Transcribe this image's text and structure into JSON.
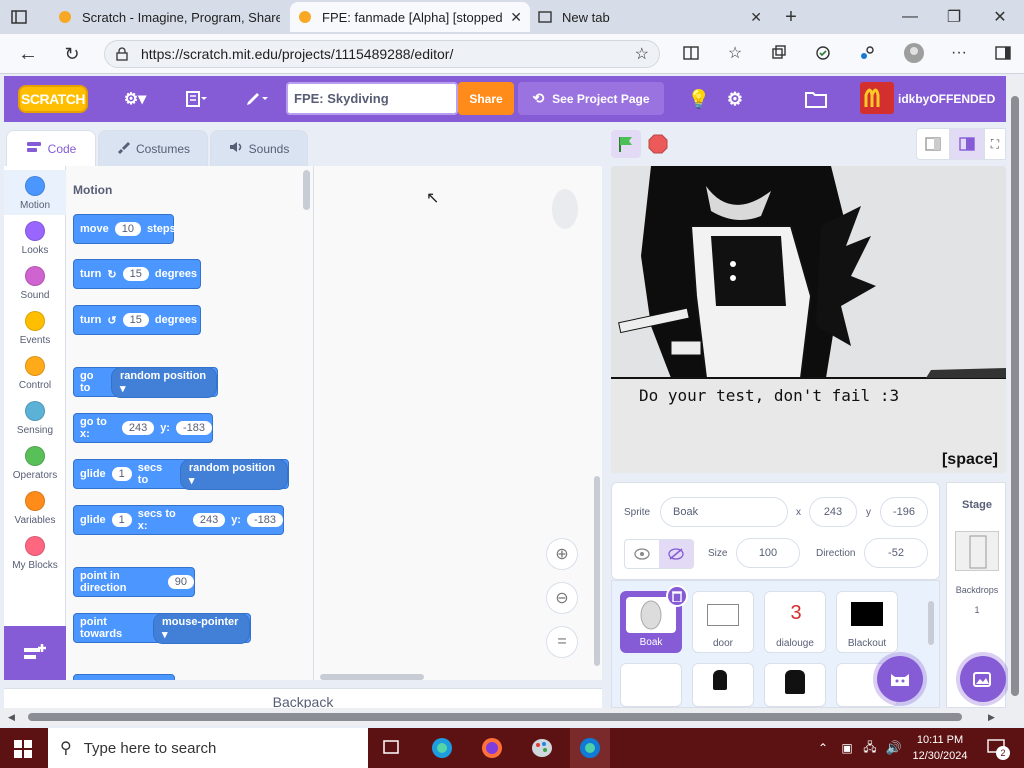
{
  "browser": {
    "tabs": [
      {
        "title": "Scratch - Imagine, Program, Share",
        "favicon": "scratch-favicon"
      },
      {
        "title": "FPE: fanmade [Alpha] [stopped up",
        "favicon": "scratch-favicon"
      },
      {
        "title": "New tab",
        "favicon": "new-tab-icon"
      }
    ],
    "url": "https://scratch.mit.edu/projects/1115489288/editor/",
    "window_controls": [
      "—",
      "❐",
      "✕"
    ]
  },
  "menubar": {
    "logo": "SCRATCH",
    "project_title": "FPE: Skydiving",
    "share_label": "Share",
    "see_project_label": "See Project Page",
    "username": "idkbyOFFENDED"
  },
  "editor_tabs": [
    "Code",
    "Costumes",
    "Sounds"
  ],
  "categories": [
    {
      "label": "Motion",
      "color": "#4c97ff"
    },
    {
      "label": "Looks",
      "color": "#9966ff"
    },
    {
      "label": "Sound",
      "color": "#cf63cf"
    },
    {
      "label": "Events",
      "color": "#ffbf00"
    },
    {
      "label": "Control",
      "color": "#ffab19"
    },
    {
      "label": "Sensing",
      "color": "#5cb1d6"
    },
    {
      "label": "Operators",
      "color": "#59c059"
    },
    {
      "label": "Variables",
      "color": "#ff8c1a"
    },
    {
      "label": "My Blocks",
      "color": "#ff6680"
    }
  ],
  "palette": {
    "heading": "Motion",
    "blocks": {
      "move": {
        "a": "move",
        "v": "10",
        "b": "steps"
      },
      "turn_cw": {
        "a": "turn",
        "v": "15",
        "b": "degrees"
      },
      "turn_ccw": {
        "a": "turn",
        "v": "15",
        "b": "degrees"
      },
      "goto": {
        "a": "go to",
        "dd": "random position"
      },
      "gotoxy": {
        "a": "go to x:",
        "x": "243",
        "b": "y:",
        "y": "-183"
      },
      "glide": {
        "a": "glide",
        "v": "1",
        "b": "secs to",
        "dd": "random position"
      },
      "glidexy": {
        "a": "glide",
        "v": "1",
        "b": "secs to x:",
        "x": "243",
        "c": "y:",
        "y": "-183"
      },
      "point_dir": {
        "a": "point in direction",
        "v": "90"
      },
      "point_towards": {
        "a": "point towards",
        "dd": "mouse-pointer"
      }
    }
  },
  "stage": {
    "dialogue": "Do your test, don't fail :3",
    "hint": "[space]"
  },
  "sprite_info": {
    "sprite_label": "Sprite",
    "sprite_name": "Boak",
    "x_label": "x",
    "x": "243",
    "y_label": "y",
    "y": "-196",
    "size_label": "Size",
    "size": "100",
    "direction_label": "Direction",
    "direction": "-52"
  },
  "sprites": [
    {
      "name": "Boak"
    },
    {
      "name": "door"
    },
    {
      "name": "dialouge",
      "glyph": "3"
    },
    {
      "name": "Blackout"
    }
  ],
  "stage_panel": {
    "title": "Stage",
    "backdrops_label": "Backdrops",
    "backdrops_count": "1"
  },
  "backpack_label": "Backpack",
  "taskbar": {
    "search_placeholder": "Type here to search",
    "time": "10:11 PM",
    "date": "12/30/2024",
    "notifications": "2"
  }
}
